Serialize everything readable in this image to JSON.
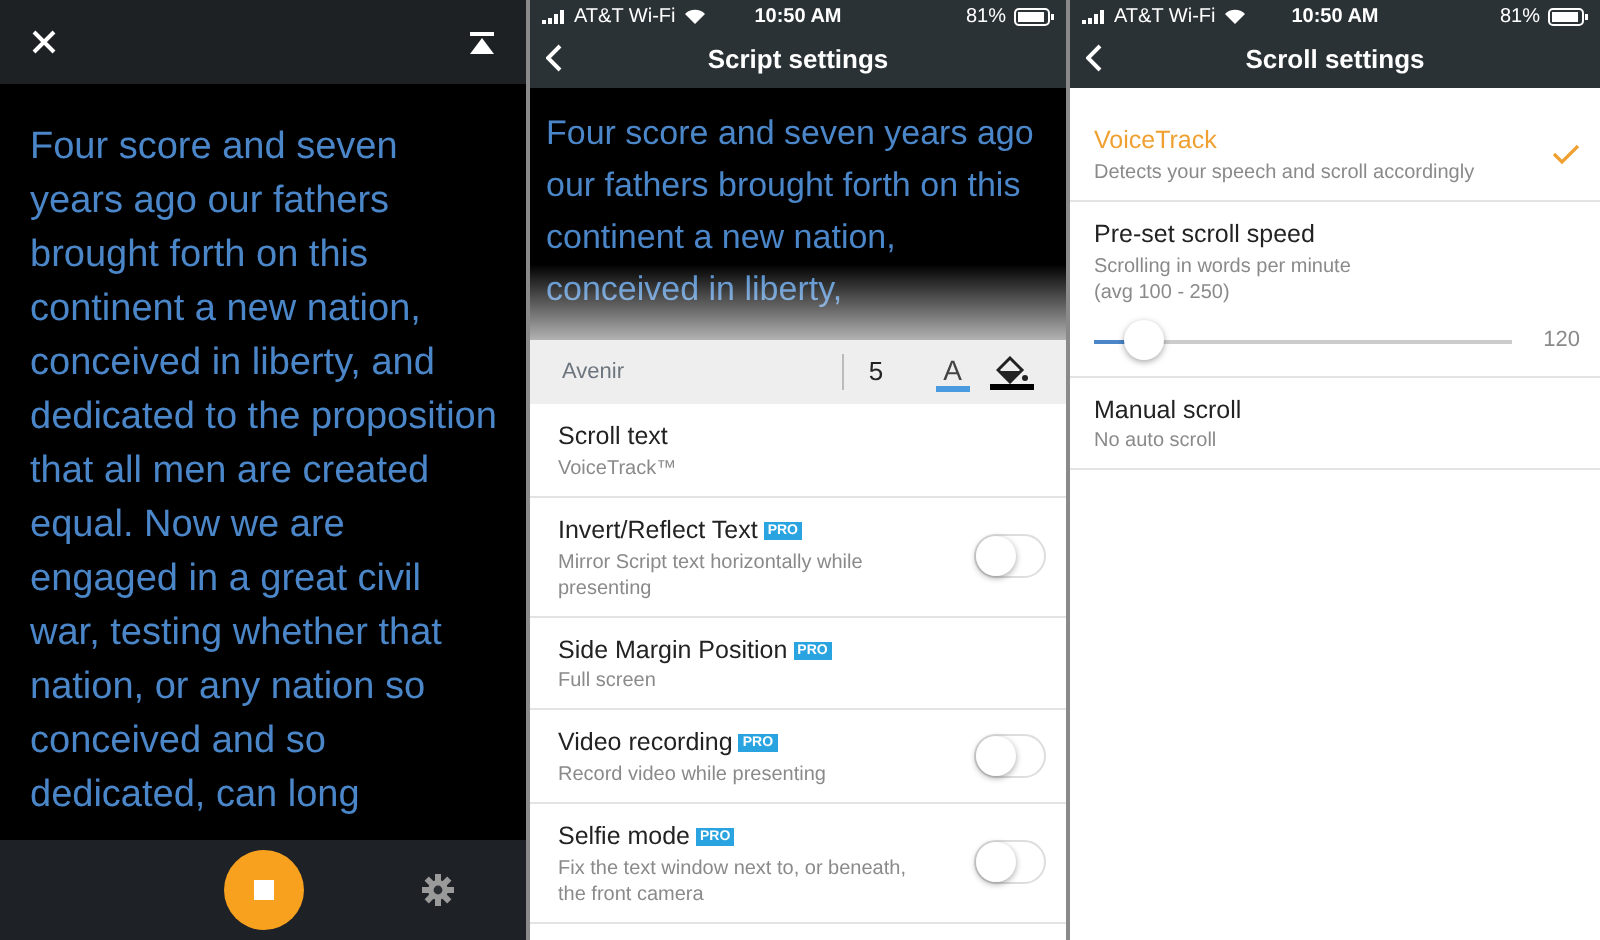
{
  "reader": {
    "script_text": "Four score and seven years ago our fathers brought forth on this continent a new nation, conceived in liberty, and dedicated to the proposition that all men are created equal. Now we are engaged in a great civil war, testing whether that nation, or any nation so conceived and so dedicated, can long"
  },
  "script_settings": {
    "status_bar": {
      "carrier": "AT&T Wi-Fi",
      "time": "10:50 AM",
      "battery": "81%"
    },
    "title": "Script settings",
    "preview_text": "Four score and seven years ago our fathers brought forth on this continent a new nation, conceived in liberty,",
    "toolbar": {
      "font": "Avenir",
      "size": "5",
      "text_color_label": "A"
    },
    "rows": [
      {
        "title": "Scroll text",
        "subtitle": "VoiceTrack™",
        "kind": "plain"
      },
      {
        "title": "Invert/Reflect Text",
        "badge": "PRO",
        "subtitle": "Mirror Script text horizontally while presenting",
        "kind": "toggle",
        "on": false
      },
      {
        "title": "Side Margin Position",
        "badge": "PRO",
        "subtitle": "Full screen",
        "kind": "plain"
      },
      {
        "title": "Video recording",
        "badge": "PRO",
        "subtitle": "Record video while presenting",
        "kind": "toggle",
        "on": false
      },
      {
        "title": "Selfie mode",
        "badge": "PRO",
        "subtitle": "Fix the text window next to, or beneath, the front camera",
        "kind": "toggle",
        "on": false
      }
    ]
  },
  "scroll_settings": {
    "status_bar": {
      "carrier": "AT&T Wi-Fi",
      "time": "10:50 AM",
      "battery": "81%"
    },
    "title": "Scroll settings",
    "options": [
      {
        "title": "VoiceTrack",
        "subtitle": "Detects your speech and scroll accordingly",
        "kind": "choice",
        "selected": true
      },
      {
        "title": "Pre-set scroll speed",
        "subtitle": "Scrolling in words per minute",
        "note": "(avg 100 - 250)",
        "kind": "slider",
        "selected": false,
        "level": 0.12,
        "reading": "120"
      },
      {
        "title": "Manual scroll",
        "subtitle": "No auto scroll",
        "kind": "choice",
        "selected": false
      }
    ]
  }
}
